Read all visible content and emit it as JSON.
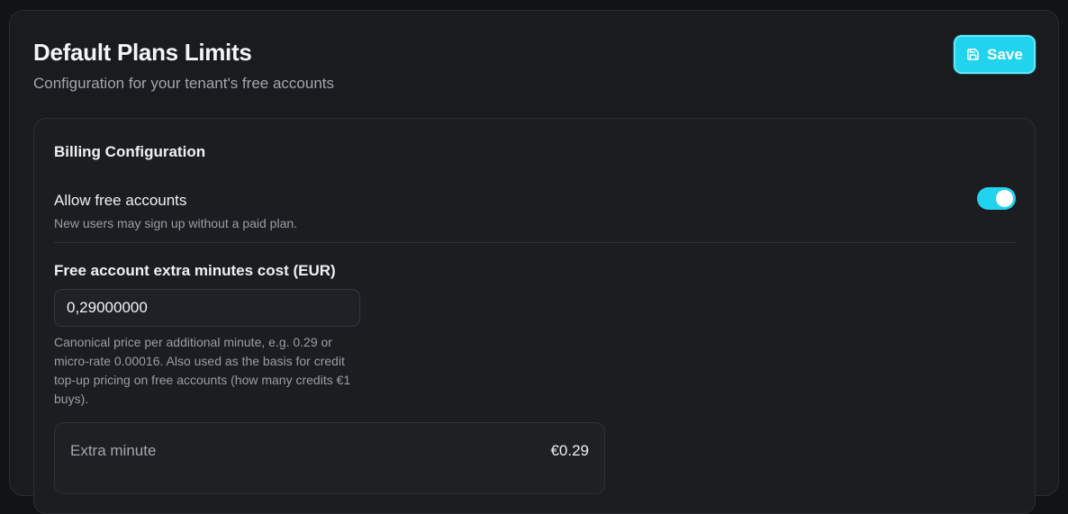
{
  "header": {
    "title": "Default Plans Limits",
    "subtitle": "Configuration for your tenant's free accounts",
    "save_label": "Save",
    "save_icon": "save-icon"
  },
  "billing": {
    "section_title": "Billing Configuration",
    "allow_free": {
      "label": "Allow free accounts",
      "description": "New users may sign up without a paid plan.",
      "enabled": true
    },
    "extra_minutes_cost": {
      "label": "Free account extra minutes cost (EUR)",
      "value": "0,29000000",
      "help": "Canonical price per additional minute, e.g. 0.29 or micro-rate 0.00016. Also used as the basis for credit top-up pricing on free accounts (how many credits €1 buys)."
    },
    "preview": {
      "label": "Extra minute",
      "value": "€0.29"
    }
  },
  "colors": {
    "accent": "#22d3ee",
    "background": "#121316",
    "card": "#1a1b1f"
  }
}
